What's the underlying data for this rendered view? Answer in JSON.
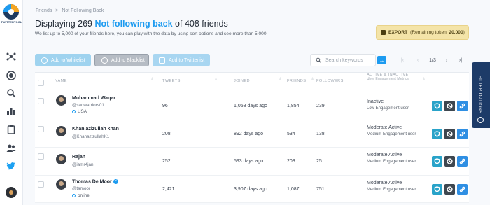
{
  "app": {
    "logo_text": "TWITTERTOOL"
  },
  "breadcrumb": {
    "root": "Friends",
    "sep": ">",
    "current": "Not Following Back"
  },
  "header": {
    "title_prefix": "Displaying 269 ",
    "title_highlight": "Not following back",
    "title_suffix": " of 408 friends",
    "subtitle": "We list up to 5,000 of your friends here, you can play with the data by using sort options and see more than 5,000."
  },
  "export": {
    "label": "EXPORT",
    "remaining_prefix": "(Remaining token: ",
    "remaining_value": "20.000",
    "remaining_suffix": ")"
  },
  "toolbar": {
    "whitelist_label": "Add to Whitelist",
    "blacklist_label": "Add to Blacklist",
    "twitterlist_label": "Add to Twitterlist"
  },
  "search": {
    "placeholder": "Search keywords",
    "value": ""
  },
  "pager": {
    "first": "|‹",
    "prev": "‹",
    "count": "1/3",
    "next": "›",
    "last": "›|"
  },
  "table": {
    "headers": {
      "name": "NAME",
      "tweets": "TWEETS",
      "joined": "JOINED",
      "friends": "FRIENDS",
      "followers": "FOLLOWERS",
      "activity": "ACTIVE & INACTIVE",
      "activity_sub": "User Engagement Metrics"
    },
    "rows": [
      {
        "name": "Muhammad Waqar",
        "handle": "@saowarriors01",
        "location": "USA",
        "verified": false,
        "tweets": "96",
        "joined": "1,058 days ago",
        "friends": "1,854",
        "followers": "239",
        "activity": "Inactive",
        "engagement": "Low Engagement user"
      },
      {
        "name": "Khan azizullah khan",
        "handle": "@KhanazizullahK1",
        "location": "",
        "verified": false,
        "tweets": "208",
        "joined": "892 days ago",
        "friends": "534",
        "followers": "138",
        "activity": "Moderate Active",
        "engagement": "Medium Engagement user"
      },
      {
        "name": "Rajan",
        "handle": "@iamr4jan",
        "location": "",
        "verified": false,
        "tweets": "252",
        "joined": "593 days ago",
        "friends": "203",
        "followers": "25",
        "activity": "Moderate Active",
        "engagement": "Medium Engagement user"
      },
      {
        "name": "Thomas De Moor",
        "handle": "@tamoor",
        "location": "online",
        "verified": true,
        "tweets": "2,421",
        "joined": "3,907 days ago",
        "friends": "1,087",
        "followers": "751",
        "activity": "Moderate Active",
        "engagement": "Medium Engagement user"
      }
    ]
  },
  "filter_tab": {
    "label": "FILTER OPTIONS"
  },
  "colors": {
    "accent": "#1d9bf0",
    "sidebar_active": "#1da1f2",
    "filter_tab": "#1d3b68",
    "export_bg": "#f4e4a8"
  },
  "icons": {
    "sidebar": [
      "network-icon",
      "record-icon",
      "search-icon",
      "bar-chart-icon",
      "clipboard-icon",
      "users-icon",
      "twitter-bird-icon"
    ]
  }
}
